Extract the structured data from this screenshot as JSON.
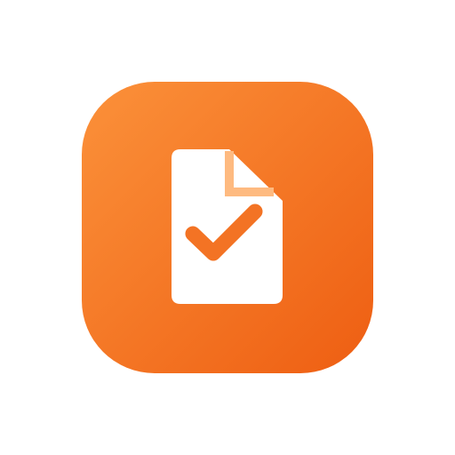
{
  "icon": {
    "name": "document-check-app-icon",
    "background_gradient": [
      "#FB913A",
      "#EE5E12"
    ],
    "document_color": "#FFFFFF",
    "fold_color": "#FEBA80",
    "checkmark_color": "#F37324"
  }
}
